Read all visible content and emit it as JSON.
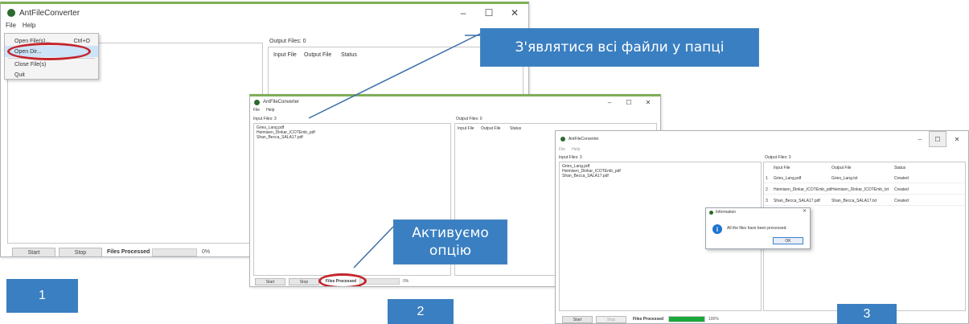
{
  "colors": {
    "callout_bg": "#3a7fc1",
    "highlight_ellipse": "#c3252b",
    "progress_fill": "#1aa83a",
    "menu_highlight": "#cde3f7"
  },
  "window1": {
    "title": "AntFileConverter",
    "controls": {
      "minimize": "–",
      "maximize": "☐",
      "close": "✕"
    },
    "menu": [
      "File",
      "Help"
    ],
    "dropdown": {
      "items": [
        {
          "label": "Open File(s)...",
          "shortcut": "Ctrl+O"
        },
        {
          "label": "Open Dir...",
          "shortcut": ""
        },
        {
          "label": "Close File(s)",
          "shortcut": ""
        },
        {
          "label": "Quit",
          "shortcut": ""
        }
      ]
    },
    "output_label": "Output Files: 0",
    "output_headers": [
      "Input File",
      "Output File",
      "Status"
    ],
    "start": "Start",
    "stop": "Stop",
    "files_processed": "Files Processed",
    "percent": "0%",
    "progress": 0
  },
  "window2": {
    "title": "AntFileConverter",
    "controls": {
      "minimize": "–",
      "maximize": "☐",
      "close": "✕"
    },
    "menu": [
      "File",
      "Help"
    ],
    "input_label": "Input Files: 3",
    "input_files": [
      "Gries_Lang.pdf",
      "Heimisen_Dinkar_ICOTEmb_pdf",
      "Shan_Becca_SALA17.pdf"
    ],
    "output_label": "Output Files: 0",
    "output_headers": [
      "Input File",
      "Output File",
      "Status"
    ],
    "start": "Start",
    "stop": "Stop",
    "files_processed": "Files Processed",
    "percent": "0%",
    "progress": 0
  },
  "window3": {
    "title": "AntFileConverter",
    "controls": {
      "minimize": "–",
      "maximize": "☐",
      "close": "✕"
    },
    "menu": [
      "File",
      "Help"
    ],
    "input_label": "Input Files: 3",
    "input_files": [
      "Gries_Lang.pdf",
      "Heimisen_Dinkar_ICOTEmb_pdf",
      "Shan_Becca_SALA17.pdf"
    ],
    "output_label": "Output Files: 3",
    "output_headers": [
      "",
      "Input File",
      "Output File",
      "Status"
    ],
    "output_rows": [
      [
        "1",
        "Gries_Lang.pdf",
        "Gries_Lang.txt",
        "Created"
      ],
      [
        "2",
        "Heimisen_Dinkar_ICOTEmb_pdf",
        "Heimisen_Dinkar_ICOTEmb_txt",
        "Created"
      ],
      [
        "3",
        "Shan_Becca_SALA17.pdf",
        "Shan_Becca_SALA17.txt",
        "Created"
      ]
    ],
    "start": "Start",
    "stop": "Stop",
    "files_processed": "Files Processed",
    "percent": "100%",
    "progress": 1.0
  },
  "dialog": {
    "title": "Information",
    "close": "✕",
    "icon": "i",
    "message": "All the files have been processed.",
    "ok": "OK"
  },
  "callouts": {
    "top": "З'являтися всі файли у папці",
    "middle_line1": "Активуємо",
    "middle_line2": "опцію"
  },
  "steps": [
    "1",
    "2",
    "3"
  ]
}
